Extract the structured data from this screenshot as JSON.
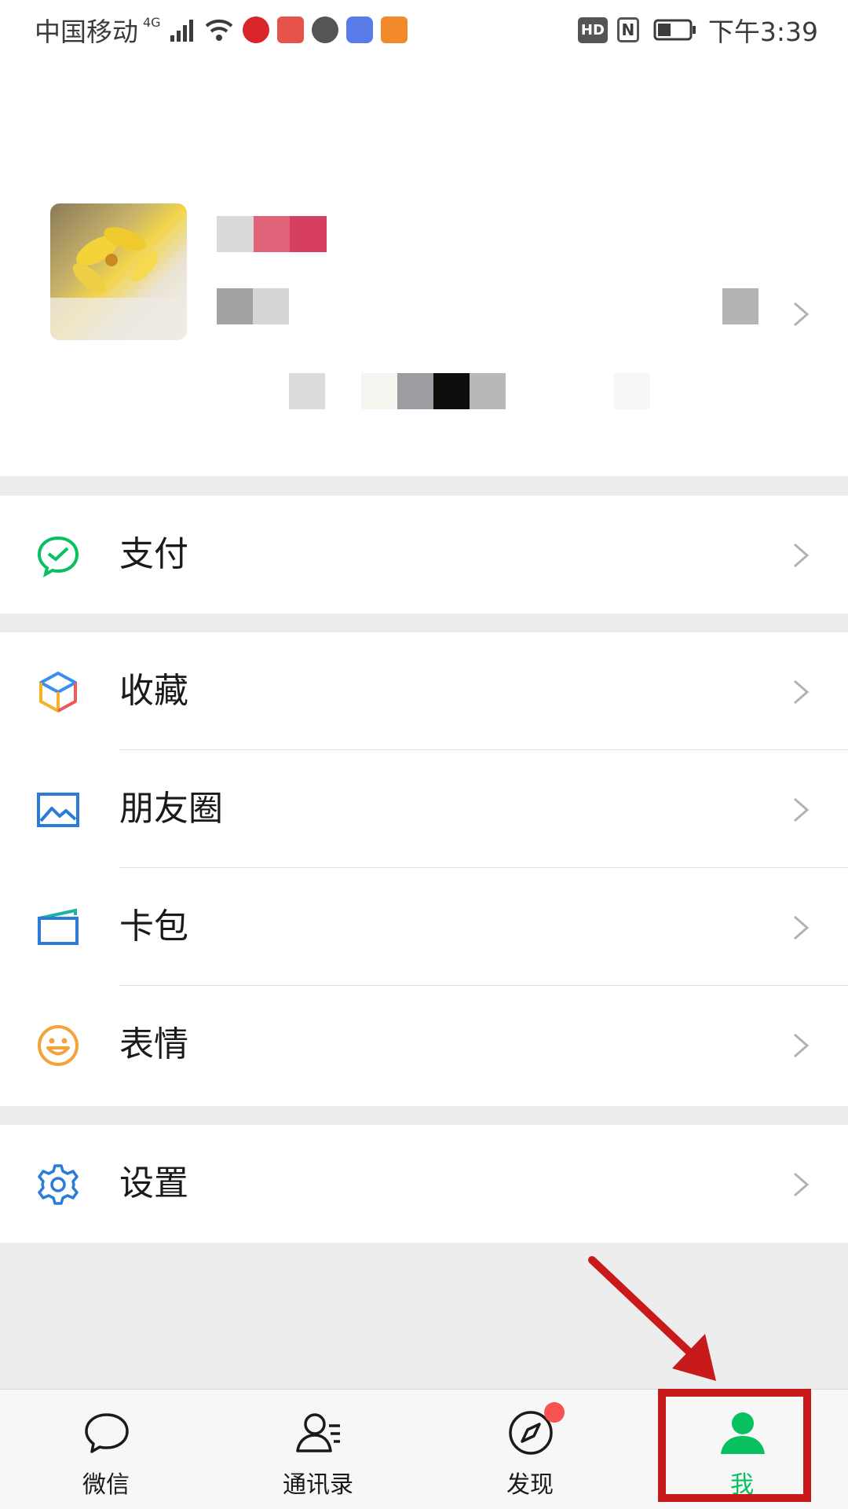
{
  "status_bar": {
    "carrier": "中国移动",
    "network": "4G",
    "time": "下午3:39",
    "hd_label": "HD",
    "nfc_label": "N"
  },
  "menu": {
    "pay": "支付",
    "favorites": "收藏",
    "moments": "朋友圈",
    "cards": "卡包",
    "stickers": "表情",
    "settings": "设置"
  },
  "tabs": [
    {
      "label": "微信",
      "icon": "chat-icon"
    },
    {
      "label": "通讯录",
      "icon": "contacts-icon"
    },
    {
      "label": "发现",
      "icon": "compass-icon",
      "badge": true
    },
    {
      "label": "我",
      "icon": "me-icon",
      "active": true
    }
  ],
  "colors": {
    "accent": "#07c160",
    "badge": "#fa5151",
    "annotation": "#c81a1a"
  }
}
